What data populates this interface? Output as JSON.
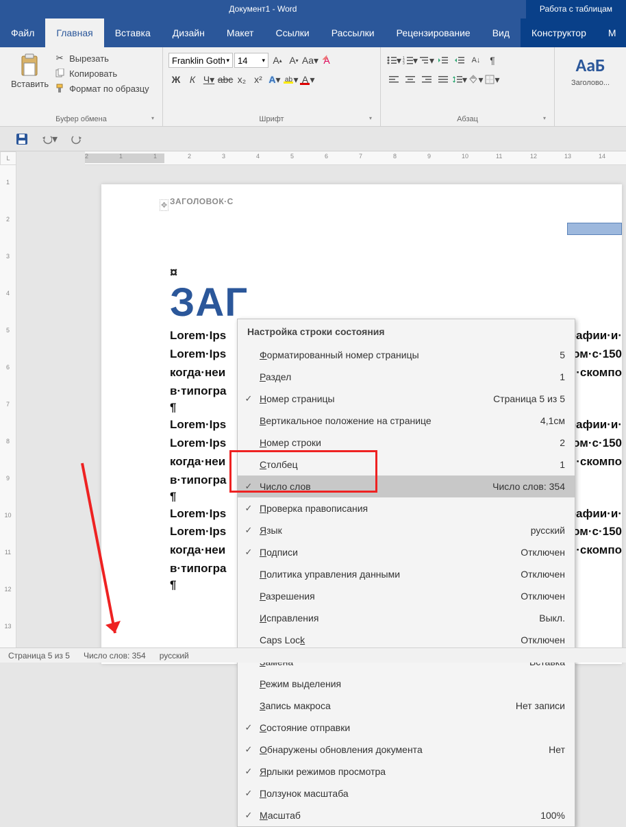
{
  "title": {
    "center": "Документ1 - Word",
    "right": "Работа с таблицам"
  },
  "tabs": {
    "file": "Файл",
    "home": "Главная",
    "insert": "Вставка",
    "design": "Дизайн",
    "layout": "Макет",
    "refs": "Ссылки",
    "mail": "Рассылки",
    "review": "Рецензирование",
    "view": "Вид",
    "constructor": "Конструктор",
    "more": "М"
  },
  "ribbon": {
    "clipboard": {
      "label": "Буфер обмена",
      "paste": "Вставить",
      "cut": "Вырезать",
      "copy": "Копировать",
      "format": "Формат по образцу"
    },
    "font": {
      "label": "Шрифт",
      "name": "Franklin Goth",
      "size": "14",
      "bold": "Ж",
      "italic": "К",
      "underline": "Ч",
      "strike": "abc",
      "sub": "x₂",
      "sup": "x²",
      "effects": "A",
      "highlight": "ab",
      "color": "A"
    },
    "para": {
      "label": "Абзац"
    },
    "styles": {
      "preview": "АаБ",
      "name": "Заголово..."
    }
  },
  "hruler": {
    "marks": [
      "2",
      "1",
      "1",
      "2",
      "3",
      "4",
      "5",
      "6",
      "7",
      "8",
      "9",
      "10",
      "11",
      "12",
      "13",
      "14"
    ]
  },
  "vruler": {
    "marks": [
      "1",
      "2",
      "3",
      "4",
      "5",
      "6",
      "7",
      "8",
      "9",
      "10",
      "11",
      "12",
      "13"
    ]
  },
  "page": {
    "header_label": "ЗАГОЛОВОК·С",
    "currency": "¤",
    "heading": "ЗАГ",
    "para1": [
      "Lorem·Ips",
      "Lorem·Ips",
      "когда·неи",
      "в·типогра"
    ],
    "right1": [
      "рафии·и·",
      "ом·с·150",
      "·скомпо"
    ],
    "pilcrow": "¶"
  },
  "context": {
    "title": "Настройка строки состояния",
    "items": [
      {
        "checked": false,
        "label_u": "Ф",
        "label_r": "орматированный номер страницы",
        "value": "5"
      },
      {
        "checked": false,
        "label_u": "Р",
        "label_r": "аздел",
        "value": "1"
      },
      {
        "checked": true,
        "label_u": "Н",
        "label_r": "омер страницы",
        "value": "Страница 5 из 5"
      },
      {
        "checked": false,
        "label_u": "В",
        "label_r": "ертикальное положение на странице",
        "value": "4,1см"
      },
      {
        "checked": false,
        "label_u": "Н",
        "label_r": "омер строки",
        "value": "2"
      },
      {
        "checked": false,
        "label_u": "С",
        "label_r": "толбец",
        "value": "1"
      },
      {
        "checked": true,
        "label_u": "Ч",
        "label_r": "исло слов",
        "value": "Число слов: 354",
        "hl": true
      },
      {
        "checked": true,
        "label_u": "П",
        "label_r": "роверка правописания",
        "value": ""
      },
      {
        "checked": true,
        "label_u": "Я",
        "label_r": "зык",
        "value": "русский"
      },
      {
        "checked": true,
        "label_u": "П",
        "label_r": "одписи",
        "value": "Отключен"
      },
      {
        "checked": false,
        "label_u": "П",
        "label_r": "олитика управления данными",
        "value": "Отключен"
      },
      {
        "checked": false,
        "label_u": "Р",
        "label_r": "азрешения",
        "value": "Отключен"
      },
      {
        "checked": false,
        "label_u": "И",
        "label_r": "справления",
        "value": "Выкл."
      },
      {
        "checked": false,
        "label_u": "",
        "label_r": "Caps Lock",
        "value": "Отключен",
        "caps": true
      },
      {
        "checked": false,
        "label_u": "З",
        "label_r": "амена",
        "value": "Вставка"
      },
      {
        "checked": false,
        "label_u": "Р",
        "label_r": "ежим выделения",
        "value": ""
      },
      {
        "checked": false,
        "label_u": "З",
        "label_r": "апись макроса",
        "value": "Нет записи"
      },
      {
        "checked": true,
        "label_u": "С",
        "label_r": "остояние отправки",
        "value": ""
      },
      {
        "checked": true,
        "label_u": "О",
        "label_r": "бнаружены обновления документа",
        "value": "Нет"
      },
      {
        "checked": true,
        "label_u": "Я",
        "label_r": "рлыки режимов просмотра",
        "value": ""
      },
      {
        "checked": true,
        "label_u": "П",
        "label_r": "олзунок масштаба",
        "value": ""
      },
      {
        "checked": true,
        "label_u": "М",
        "label_r": "асштаб",
        "value": "100%"
      }
    ]
  },
  "statusbar": {
    "page": "Страница 5 из 5",
    "words": "Число слов: 354",
    "lang": "русский"
  }
}
